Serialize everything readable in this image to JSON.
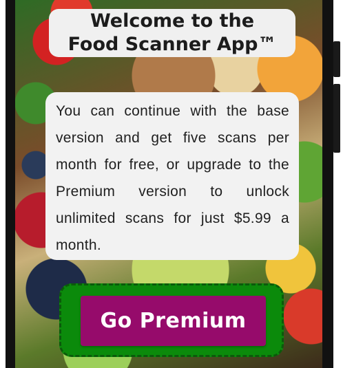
{
  "header": {
    "title_line1": "Welcome to the",
    "title_line2": "Food Scanner App™"
  },
  "message": {
    "text": "You can continue with the base version and get five scans per month for free, or upgrade to the Premium version  to unlock unlimited scans for just $5.99 a month."
  },
  "actions": {
    "premium_label": "Go Premium"
  },
  "colors": {
    "premium_button": "#960b6b",
    "premium_border": "#0b8a0b",
    "card_background": "#f2f2f2"
  }
}
